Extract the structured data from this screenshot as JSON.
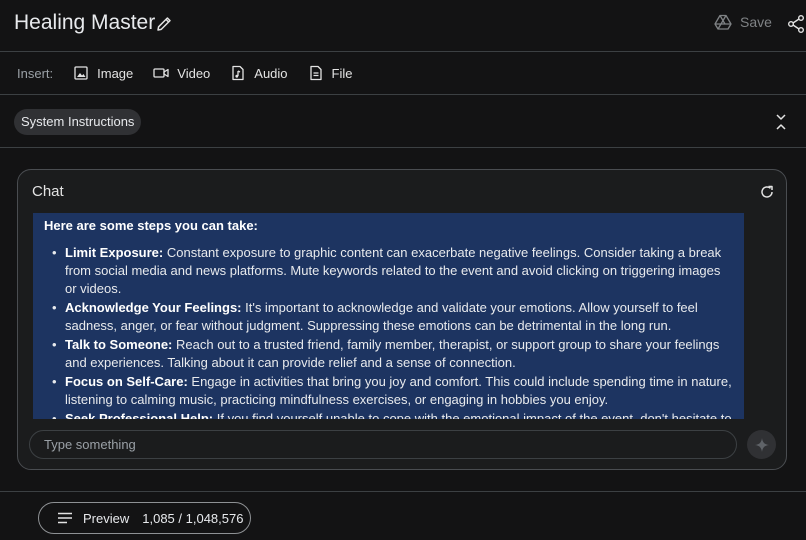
{
  "header": {
    "title": "Healing Master",
    "save_label": "Save"
  },
  "insert_bar": {
    "label": "Insert:",
    "buttons": [
      "Image",
      "Video",
      "Audio",
      "File"
    ]
  },
  "system_instructions": {
    "label": "System Instructions"
  },
  "chat": {
    "title": "Chat",
    "intro": "Here are some steps you can take:",
    "steps": [
      {
        "title": "Limit Exposure:",
        "text": " Constant exposure to graphic content can exacerbate negative feelings. Consider taking a break from social media and news platforms. Mute keywords related to the event and avoid clicking on triggering images or videos."
      },
      {
        "title": "Acknowledge Your Feelings:",
        "text": " It's important to acknowledge and validate your emotions. Allow yourself to feel sadness, anger, or fear without judgment. Suppressing these emotions can be detrimental in the long run."
      },
      {
        "title": "Talk to Someone:",
        "text": " Reach out to a trusted friend, family member, therapist, or support group to share your feelings and experiences. Talking about it can provide relief and a sense of connection."
      },
      {
        "title": "Focus on Self-Care:",
        "text": " Engage in activities that bring you joy and comfort. This could include spending time in nature, listening to calming music, practicing mindfulness exercises, or engaging in hobbies you enjoy."
      },
      {
        "title": "Seek Professional Help:",
        "text": " If you find yourself unable to cope with the emotional impact of the event, don't hesitate to seek professional help. Therapists can provide you with tools and strategies to process your emotions and cope with trauma."
      }
    ],
    "input_placeholder": "Type something"
  },
  "footer": {
    "preview_label": "Preview",
    "token_count": "1,085 / 1,048,576"
  },
  "colors": {
    "background": "#131314",
    "response_highlight": "#1d3461",
    "border": "#3c4043"
  }
}
